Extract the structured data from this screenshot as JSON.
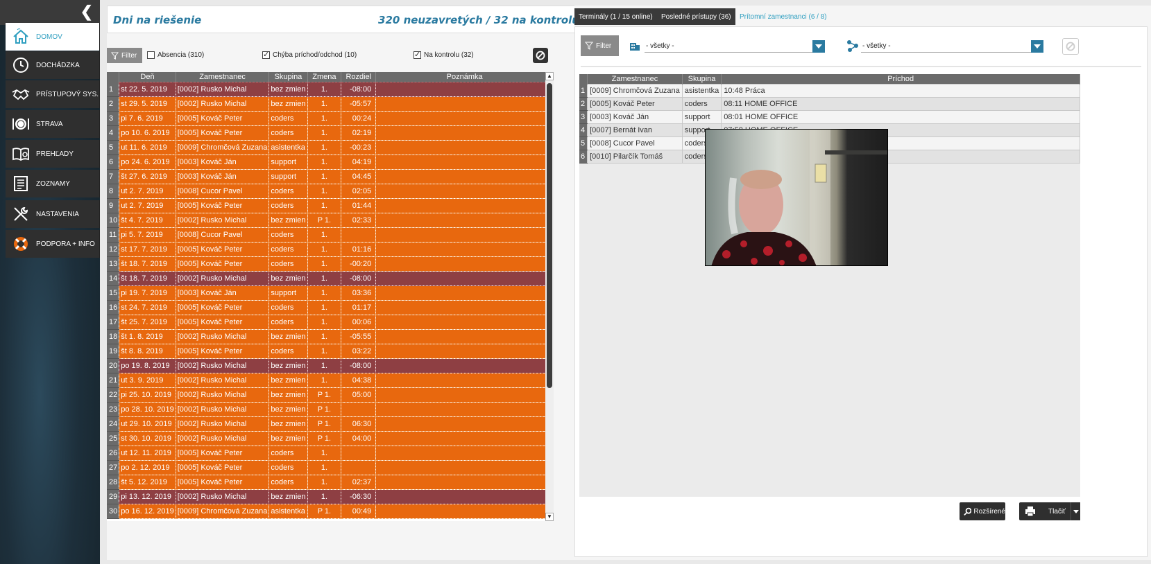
{
  "sidebar": {
    "items": [
      {
        "label": "DOMOV",
        "icon": "home-icon",
        "active": true
      },
      {
        "label": "DOCHÁDZKA",
        "icon": "clock-icon",
        "active": false
      },
      {
        "label": "PRÍSTUPOVÝ SYS.",
        "icon": "handshake-icon",
        "active": false
      },
      {
        "label": "STRAVA",
        "icon": "plate-cutlery-icon",
        "active": false
      },
      {
        "label": "PREHĽADY",
        "icon": "book-icon",
        "active": false
      },
      {
        "label": "ZOZNAMY",
        "icon": "list-icon",
        "active": false
      },
      {
        "label": "NASTAVENIA",
        "icon": "tools-icon",
        "active": false
      },
      {
        "label": "PODPORA + INFO",
        "icon": "lifebuoy-icon",
        "active": false
      }
    ]
  },
  "left": {
    "title": "Dni na riešenie",
    "summary": "320 neuzavretých / 32 na kontrolu",
    "filter_label": "Filter",
    "checks": [
      {
        "label": "Absencia (310)",
        "checked": false
      },
      {
        "label": "Chýba príchod/odchod (10)",
        "checked": true
      },
      {
        "label": "Na kontrolu (32)",
        "checked": true
      }
    ],
    "columns": [
      "Deň",
      "Zamestnanec",
      "Skupina",
      "Zmena",
      "Rozdiel",
      "Poznámka"
    ],
    "rows": [
      {
        "n": "1",
        "day": "st 22. 5. 2019",
        "emp": "[0002] Rusko Michal",
        "grp": "bez zmien",
        "shift": "1.",
        "diff": "-08:00",
        "note": "",
        "style": "dark"
      },
      {
        "n": "2",
        "day": "st 29. 5. 2019",
        "emp": "[0002] Rusko Michal",
        "grp": "bez zmien",
        "shift": "1.",
        "diff": "-05:57",
        "note": "",
        "style": "orange"
      },
      {
        "n": "3",
        "day": "pi 7. 6. 2019",
        "emp": "[0005] Kováč Peter",
        "grp": "coders",
        "shift": "1.",
        "diff": "00:24",
        "note": "",
        "style": "orange"
      },
      {
        "n": "4",
        "day": "po 10. 6. 2019",
        "emp": "[0005] Kováč Peter",
        "grp": "coders",
        "shift": "1.",
        "diff": "02:19",
        "note": "",
        "style": "orange"
      },
      {
        "n": "5",
        "day": "ut 11. 6. 2019",
        "emp": "[0009] Chromčová Zuzana",
        "grp": "asistentka",
        "shift": "1.",
        "diff": "-00:23",
        "note": "",
        "style": "orange"
      },
      {
        "n": "6",
        "day": "po 24. 6. 2019",
        "emp": "[0003] Kováč Ján",
        "grp": "support",
        "shift": "1.",
        "diff": "04:19",
        "note": "",
        "style": "orange"
      },
      {
        "n": "7",
        "day": "št 27. 6. 2019",
        "emp": "[0003] Kováč Ján",
        "grp": "support",
        "shift": "1.",
        "diff": "04:45",
        "note": "",
        "style": "orange"
      },
      {
        "n": "8",
        "day": "ut 2. 7. 2019",
        "emp": "[0008] Cucor Pavel",
        "grp": "coders",
        "shift": "1.",
        "diff": "02:05",
        "note": "",
        "style": "orange"
      },
      {
        "n": "9",
        "day": "ut 2. 7. 2019",
        "emp": "[0005] Kováč Peter",
        "grp": "coders",
        "shift": "1.",
        "diff": "01:44",
        "note": "",
        "style": "orange"
      },
      {
        "n": "10",
        "day": "št 4. 7. 2019",
        "emp": "[0002] Rusko Michal",
        "grp": "bez zmien",
        "shift": "P 1.",
        "diff": "02:33",
        "note": "",
        "style": "orange"
      },
      {
        "n": "11",
        "day": "pi 5. 7. 2019",
        "emp": "[0008] Cucor Pavel",
        "grp": "coders",
        "shift": "1.",
        "diff": "",
        "note": "",
        "style": "orange"
      },
      {
        "n": "12",
        "day": "st 17. 7. 2019",
        "emp": "[0005] Kováč Peter",
        "grp": "coders",
        "shift": "1.",
        "diff": "01:16",
        "note": "",
        "style": "orange"
      },
      {
        "n": "13",
        "day": "št 18. 7. 2019",
        "emp": "[0005] Kováč Peter",
        "grp": "coders",
        "shift": "1.",
        "diff": "-00:20",
        "note": "",
        "style": "orange"
      },
      {
        "n": "14",
        "day": "št 18. 7. 2019",
        "emp": "[0002] Rusko Michal",
        "grp": "bez zmien",
        "shift": "1.",
        "diff": "-08:00",
        "note": "",
        "style": "dark"
      },
      {
        "n": "15",
        "day": "pi 19. 7. 2019",
        "emp": "[0003] Kováč Ján",
        "grp": "support",
        "shift": "1.",
        "diff": "03:36",
        "note": "",
        "style": "orange"
      },
      {
        "n": "16",
        "day": "st 24. 7. 2019",
        "emp": "[0005] Kováč Peter",
        "grp": "coders",
        "shift": "1.",
        "diff": "01:17",
        "note": "",
        "style": "orange"
      },
      {
        "n": "17",
        "day": "št 25. 7. 2019",
        "emp": "[0005] Kováč Peter",
        "grp": "coders",
        "shift": "1.",
        "diff": "00:06",
        "note": "",
        "style": "orange"
      },
      {
        "n": "18",
        "day": "št 1. 8. 2019",
        "emp": "[0002] Rusko Michal",
        "grp": "bez zmien",
        "shift": "1.",
        "diff": "-05:55",
        "note": "",
        "style": "orange"
      },
      {
        "n": "19",
        "day": "št 8. 8. 2019",
        "emp": "[0005] Kováč Peter",
        "grp": "coders",
        "shift": "1.",
        "diff": "03:22",
        "note": "",
        "style": "orange"
      },
      {
        "n": "20",
        "day": "po 19. 8. 2019",
        "emp": "[0002] Rusko Michal",
        "grp": "bez zmien",
        "shift": "1.",
        "diff": "-08:00",
        "note": "",
        "style": "dark"
      },
      {
        "n": "21",
        "day": "ut 3. 9. 2019",
        "emp": "[0002] Rusko Michal",
        "grp": "bez zmien",
        "shift": "1.",
        "diff": "04:38",
        "note": "",
        "style": "orange"
      },
      {
        "n": "22",
        "day": "pi 25. 10. 2019",
        "emp": "[0002] Rusko Michal",
        "grp": "bez zmien",
        "shift": "P 1.",
        "diff": "05:00",
        "note": "",
        "style": "orange"
      },
      {
        "n": "23",
        "day": "po 28. 10. 2019",
        "emp": "[0002] Rusko Michal",
        "grp": "bez zmien",
        "shift": "P 1.",
        "diff": "",
        "note": "",
        "style": "orange"
      },
      {
        "n": "24",
        "day": "ut 29. 10. 2019",
        "emp": "[0002] Rusko Michal",
        "grp": "bez zmien",
        "shift": "P 1.",
        "diff": "06:30",
        "note": "",
        "style": "orange"
      },
      {
        "n": "25",
        "day": "st 30. 10. 2019",
        "emp": "[0002] Rusko Michal",
        "grp": "bez zmien",
        "shift": "P 1.",
        "diff": "04:00",
        "note": "",
        "style": "orange"
      },
      {
        "n": "26",
        "day": "ut 12. 11. 2019",
        "emp": "[0005] Kováč Peter",
        "grp": "coders",
        "shift": "1.",
        "diff": "",
        "note": "",
        "style": "orange"
      },
      {
        "n": "27",
        "day": "po 2. 12. 2019",
        "emp": "[0005] Kováč Peter",
        "grp": "coders",
        "shift": "1.",
        "diff": "",
        "note": "",
        "style": "orange"
      },
      {
        "n": "28",
        "day": "št 5. 12. 2019",
        "emp": "[0005] Kováč Peter",
        "grp": "coders",
        "shift": "1.",
        "diff": "02:37",
        "note": "",
        "style": "orange"
      },
      {
        "n": "29",
        "day": "pi 13. 12. 2019",
        "emp": "[0002] Rusko Michal",
        "grp": "bez zmien",
        "shift": "1.",
        "diff": "-06:30",
        "note": "",
        "style": "dark"
      },
      {
        "n": "30",
        "day": "po 16. 12. 2019",
        "emp": "[0009] Chromčová Zuzana",
        "grp": "asistentka",
        "shift": "P 1.",
        "diff": "00:49",
        "note": "",
        "style": "orange"
      }
    ]
  },
  "right": {
    "tabs": [
      {
        "label": "Terminály (1 / 15 online)",
        "active": false
      },
      {
        "label": "Posledné prístupy (36)",
        "active": false
      },
      {
        "label": "Prítomní zamestnanci (6 / 8)",
        "active": true
      }
    ],
    "filter_label": "Filter",
    "select_building": "- všetky -",
    "select_group": "- všetky -",
    "columns": [
      "Zamestnanec",
      "Skupina",
      "Príchod"
    ],
    "rows": [
      {
        "n": "1",
        "emp": "[0009] Chromčová Zuzana",
        "grp": "asistentka",
        "arr": "10:48 Práca"
      },
      {
        "n": "2",
        "emp": "[0005] Kováč Peter",
        "grp": "coders",
        "arr": "08:11 HOME OFFICE"
      },
      {
        "n": "3",
        "emp": "[0003] Kováč Ján",
        "grp": "support",
        "arr": "08:01 HOME OFFICE"
      },
      {
        "n": "4",
        "emp": "[0007] Bernát Ivan",
        "grp": "support",
        "arr": "07:58 HOME OFFICE"
      },
      {
        "n": "5",
        "emp": "[0008] Cucor Pavel",
        "grp": "coders",
        "arr": ""
      },
      {
        "n": "6",
        "emp": "[0010] Pilarčík Tomáš",
        "grp": "coders",
        "arr": ""
      }
    ],
    "advanced_label": "Rozšírené",
    "print_label": "Tlačiť"
  },
  "colors": {
    "accent": "#2f9fc0",
    "row_orange": "#e8680e",
    "row_dark": "#8e3f43",
    "header_gray": "#6b6b6b"
  }
}
